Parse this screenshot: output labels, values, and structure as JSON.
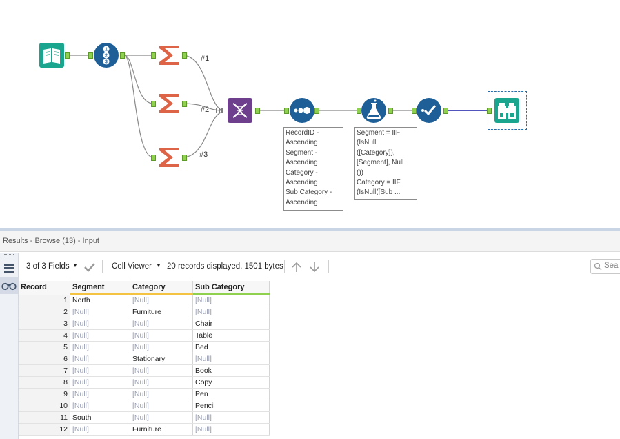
{
  "canvas": {
    "connection_labels": [
      "#1",
      "#2",
      "#3"
    ],
    "annotations": {
      "sort": [
        "RecordID -",
        "Ascending",
        "Segment -",
        "Ascending",
        "Category -",
        "Ascending",
        "Sub Category -",
        "Ascending"
      ],
      "formula": [
        "Segment = IIF",
        "(IsNull",
        "([Category]),",
        "[Segment], Null",
        "())",
        "Category = IIF",
        "(IsNull([Sub ..."
      ]
    }
  },
  "results": {
    "title": "Results - Browse (13) - Input",
    "toolbar": {
      "fields_label": "3 of 3 Fields",
      "viewer_label": "Cell Viewer",
      "records_info": "20 records displayed, 1501 bytes",
      "search_placeholder": "Sea"
    },
    "columns": [
      "Record",
      "Segment",
      "Category",
      "Sub Category"
    ],
    "column_underline_colors": [
      "#f5c342",
      "#f5c342",
      "#8fd14f"
    ],
    "rows": [
      [
        "1",
        "North",
        "[Null]",
        "[Null]"
      ],
      [
        "2",
        "[Null]",
        "Furniture",
        "[Null]"
      ],
      [
        "3",
        "[Null]",
        "[Null]",
        "Chair"
      ],
      [
        "4",
        "[Null]",
        "[Null]",
        "Table"
      ],
      [
        "5",
        "[Null]",
        "[Null]",
        "Bed"
      ],
      [
        "6",
        "[Null]",
        "Stationary",
        "[Null]"
      ],
      [
        "7",
        "[Null]",
        "[Null]",
        "Book"
      ],
      [
        "8",
        "[Null]",
        "[Null]",
        "Copy"
      ],
      [
        "9",
        "[Null]",
        "[Null]",
        "Pen"
      ],
      [
        "10",
        "[Null]",
        "[Null]",
        "Pencil"
      ],
      [
        "11",
        "South",
        "[Null]",
        "[Null]"
      ],
      [
        "12",
        "[Null]",
        "Furniture",
        "[Null]"
      ]
    ]
  },
  "colors": {
    "input_tool": "#1aa58f",
    "recordid_tool": "#1f5f98",
    "summarize_tool": "#dd6446",
    "union_tool": "#6e3f8c",
    "sort_tool": "#1f5f98",
    "formula_tool": "#1f5f98",
    "select_tool": "#1f5f98",
    "browse_tool": "#1aa58f",
    "anchor": "#8fd14f",
    "null_text": "#9aa0b4"
  }
}
